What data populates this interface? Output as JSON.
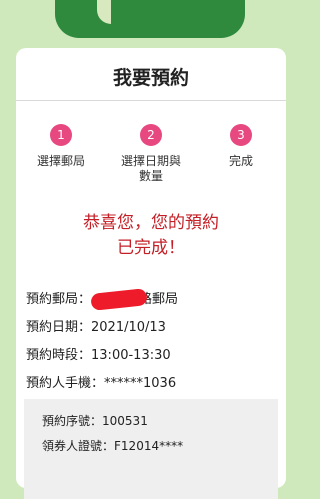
{
  "header": {
    "title": "我要預約"
  },
  "steps": [
    {
      "number": "1",
      "label": "選擇郵局"
    },
    {
      "number": "2",
      "label": "選擇日期與數量"
    },
    {
      "number": "3",
      "label": "完成"
    }
  ],
  "result": {
    "line1": "恭喜您，您的預約",
    "line2": "已完成！"
  },
  "details": {
    "post_office_label": "預約郵局：",
    "post_office_value": "路郵局",
    "date_label": "預約日期：",
    "date_value": "2021/10/13",
    "time_label": "預約時段：",
    "time_value": "13:00-13:30",
    "phone_label": "預約人手機：",
    "phone_value": "******1036"
  },
  "receipt": {
    "serial_label": "預約序號：",
    "serial_value": "100531",
    "id_label": "領券人證號：",
    "id_value": "F12014****"
  },
  "colors": {
    "background": "#cfe9bd",
    "brand_green": "#2f8a3e",
    "step_pink": "#e74880",
    "success_red": "#c41f26",
    "redaction_red": "#ee1c2b"
  }
}
